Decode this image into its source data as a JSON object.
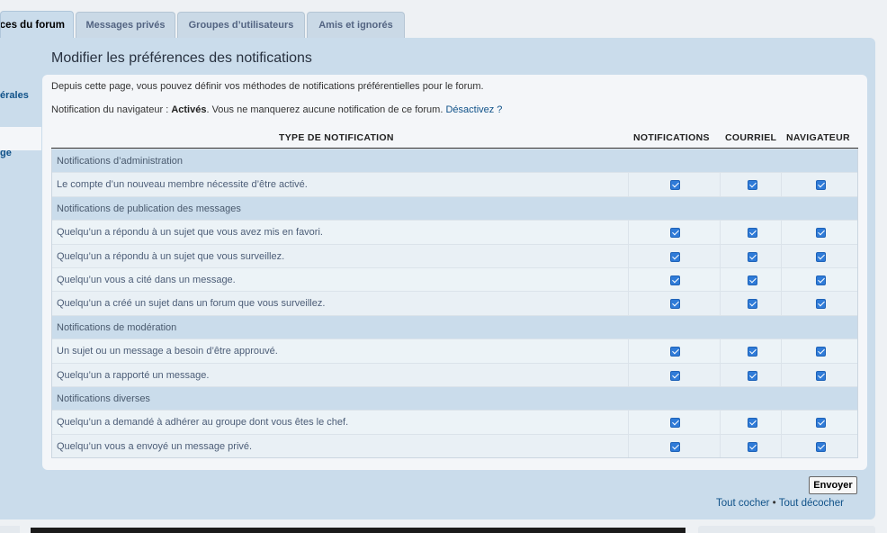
{
  "tabs": [
    {
      "label": "ces du forum",
      "active": true
    },
    {
      "label": "Messages privés",
      "active": false
    },
    {
      "label": "Groupes d’utilisateurs",
      "active": false
    },
    {
      "label": "Amis et ignorés",
      "active": false
    }
  ],
  "leftnav": [
    "érales",
    "ge"
  ],
  "title": "Modifier les préférences des notifications",
  "intro": "Depuis cette page, vous pouvez définir vos méthodes de notifications préférentielles pour le forum.",
  "browser": {
    "prefix": "Notification du navigateur : ",
    "status": "Activés",
    "suffix": ". Vous ne manquerez aucune notification de ce forum. ",
    "link": "Désactivez ?"
  },
  "headers": {
    "type": "TYPE DE NOTIFICATION",
    "notifications": "NOTIFICATIONS",
    "email": "COURRIEL",
    "browser": "NAVIGATEUR"
  },
  "rows": [
    {
      "kind": "cat",
      "label": "Notifications d’administration"
    },
    {
      "kind": "item",
      "label": "Le compte d’un nouveau membre nécessite d’être activé.",
      "checks": [
        true,
        true,
        true
      ]
    },
    {
      "kind": "cat",
      "label": "Notifications de publication des messages"
    },
    {
      "kind": "item",
      "label": "Quelqu’un a répondu à un sujet que vous avez mis en favori.",
      "checks": [
        true,
        true,
        true
      ]
    },
    {
      "kind": "item",
      "label": "Quelqu’un a répondu à un sujet que vous surveillez.",
      "checks": [
        true,
        true,
        true
      ]
    },
    {
      "kind": "item",
      "label": "Quelqu’un vous a cité dans un message.",
      "checks": [
        true,
        true,
        true
      ]
    },
    {
      "kind": "item",
      "label": "Quelqu’un a créé un sujet dans un forum que vous surveillez.",
      "checks": [
        true,
        true,
        true
      ]
    },
    {
      "kind": "cat",
      "label": "Notifications de modération"
    },
    {
      "kind": "item",
      "label": "Un sujet ou un message a besoin d’être approuvé.",
      "checks": [
        true,
        true,
        true
      ]
    },
    {
      "kind": "item",
      "label": "Quelqu’un a rapporté un message.",
      "checks": [
        true,
        true,
        true
      ]
    },
    {
      "kind": "cat",
      "label": "Notifications diverses"
    },
    {
      "kind": "item",
      "label": "Quelqu’un a demandé à adhérer au groupe dont vous êtes le chef.",
      "checks": [
        true,
        true,
        true
      ]
    },
    {
      "kind": "item",
      "label": "Quelqu’un vous a envoyé un message privé.",
      "checks": [
        true,
        true,
        true
      ]
    }
  ],
  "submit": "Envoyer",
  "check_all": "Tout cocher",
  "separator": "•",
  "uncheck_all": "Tout décocher",
  "colors": {
    "accent": "#105289",
    "panel": "#cadceb",
    "checkbox": "#2f7bd8"
  }
}
